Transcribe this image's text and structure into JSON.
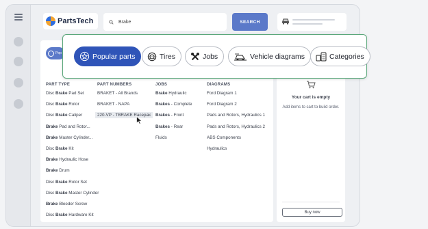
{
  "app": {
    "logo_text": "PartsTech"
  },
  "search": {
    "value": "Brake",
    "button_label": "SEARCH"
  },
  "quick_filters": [
    {
      "label": "Popular parts",
      "icon": "popular-parts-icon",
      "active": true
    },
    {
      "label": "Tires",
      "icon": "tire-icon",
      "active": false
    },
    {
      "label": "Jobs",
      "icon": "tools-icon",
      "active": false
    },
    {
      "label": "Vehicle diagrams",
      "icon": "vehicle-diagram-icon",
      "active": false
    },
    {
      "label": "Categories",
      "icon": "categories-icon",
      "active": false
    }
  ],
  "mini_chip": {
    "label": "Pop"
  },
  "columns": {
    "part_type": {
      "header": "PART TYPE",
      "items": [
        [
          "Disc ",
          "Brake",
          " Pad Set"
        ],
        [
          "Disc ",
          "Brake",
          " Rotor"
        ],
        [
          "Disc ",
          "Brake",
          " Caliper"
        ],
        [
          "",
          "Brake",
          " Pad and Rotor..."
        ],
        [
          "",
          "Brake",
          " Master Cylinder..."
        ],
        [
          "Disc ",
          "Brake",
          " Kit"
        ],
        [
          "",
          "Brake",
          " Hydraulic Hose"
        ],
        [
          "",
          "Brake",
          " Drum"
        ],
        [
          "Disc ",
          "Brake",
          " Rotor Set"
        ],
        [
          "Disc ",
          "Brake",
          " Master Cylinder"
        ],
        [
          "",
          "Brake",
          " Bleeder Screw"
        ],
        [
          "Disc ",
          "Brake",
          " Hardware Kit"
        ]
      ]
    },
    "part_numbers": {
      "header": "PART NUMBERS",
      "items": [
        "BRAKET - All Brands",
        "BRAKET - NAPA",
        "220-VP - TBRAKE Racepak"
      ]
    },
    "jobs": {
      "header": "JOBS",
      "items": [
        [
          "Brake",
          " Hydraulic"
        ],
        [
          "Brakes",
          " - Complete"
        ],
        [
          "Brakes",
          " - Front"
        ],
        [
          "Brakes",
          " - Rear"
        ],
        [
          "",
          "Fluids"
        ]
      ]
    },
    "diagrams": {
      "header": "DIAGRAMS",
      "items": [
        "Ford Diagram 1",
        "Ford Diagram 2",
        "Pads and Rotors, Hydraulics 1",
        "Pads and Rotors, Hydraulics 2",
        "ABS Components",
        "Hydraulics"
      ]
    }
  },
  "cart": {
    "title": "Your cart is empty",
    "subtitle": "Add items to cart to build order.",
    "buy_label": "Buy now"
  },
  "colors": {
    "accent": "#2f54b8",
    "search_button": "#5b79c9",
    "overlay_border": "#5aa77a"
  }
}
